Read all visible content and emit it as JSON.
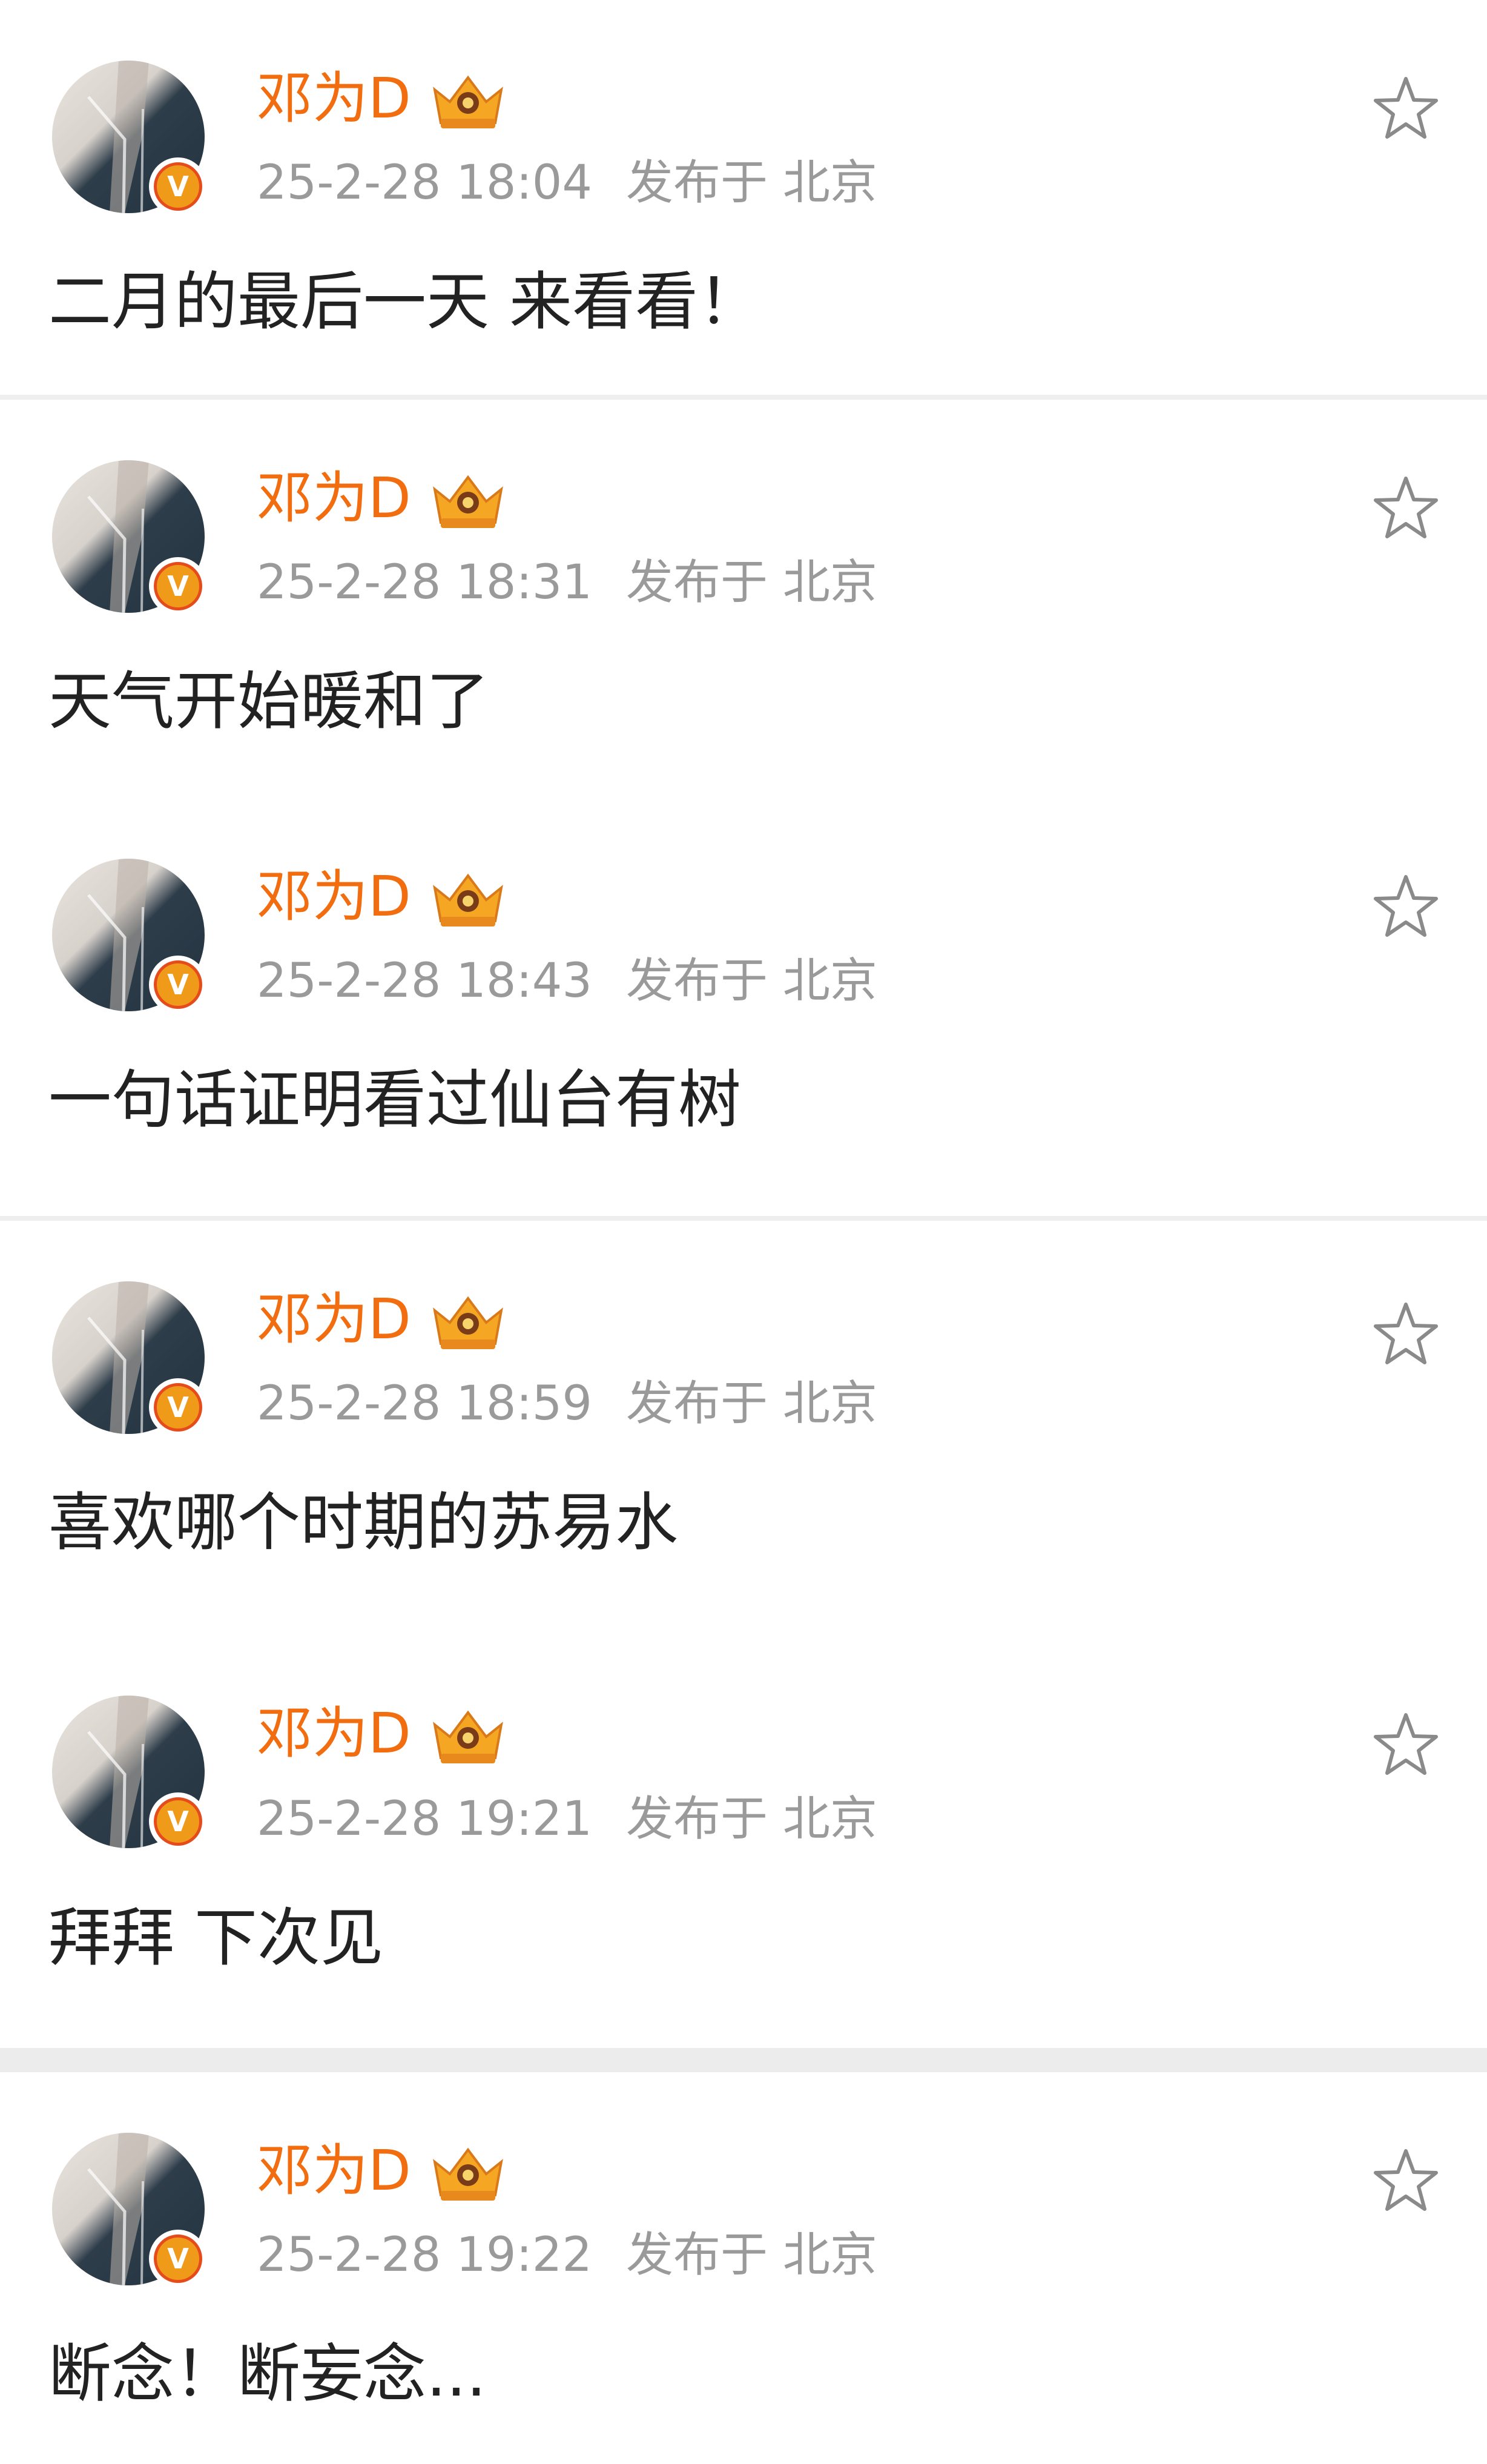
{
  "user": {
    "name": "邓为D",
    "verified_badge": "V",
    "avatar_icon": "user-avatar",
    "crown_icon": "crown-icon",
    "location_prefix": "发布于",
    "location": "北京"
  },
  "posts": [
    {
      "time": "25-2-28 18:04",
      "text": "二月的最后一天 来看看！"
    },
    {
      "time": "25-2-28 18:31",
      "text": "天气开始暖和了"
    },
    {
      "time": "25-2-28 18:43",
      "text": "一句话证明看过仙台有树"
    },
    {
      "time": "25-2-28 18:59",
      "text": "喜欢哪个时期的苏易水"
    },
    {
      "time": "25-2-28 19:21",
      "text": "拜拜 下次见"
    },
    {
      "time": "25-2-28 19:22",
      "text": "断念！断妄念..."
    }
  ],
  "colors": {
    "username": "#f26d0f",
    "meta": "#9a9a9a",
    "content": "#222222",
    "badge": "#f09a1a",
    "divider": "#eeeeee"
  },
  "icons": {
    "favorite": "star-outline-icon"
  }
}
